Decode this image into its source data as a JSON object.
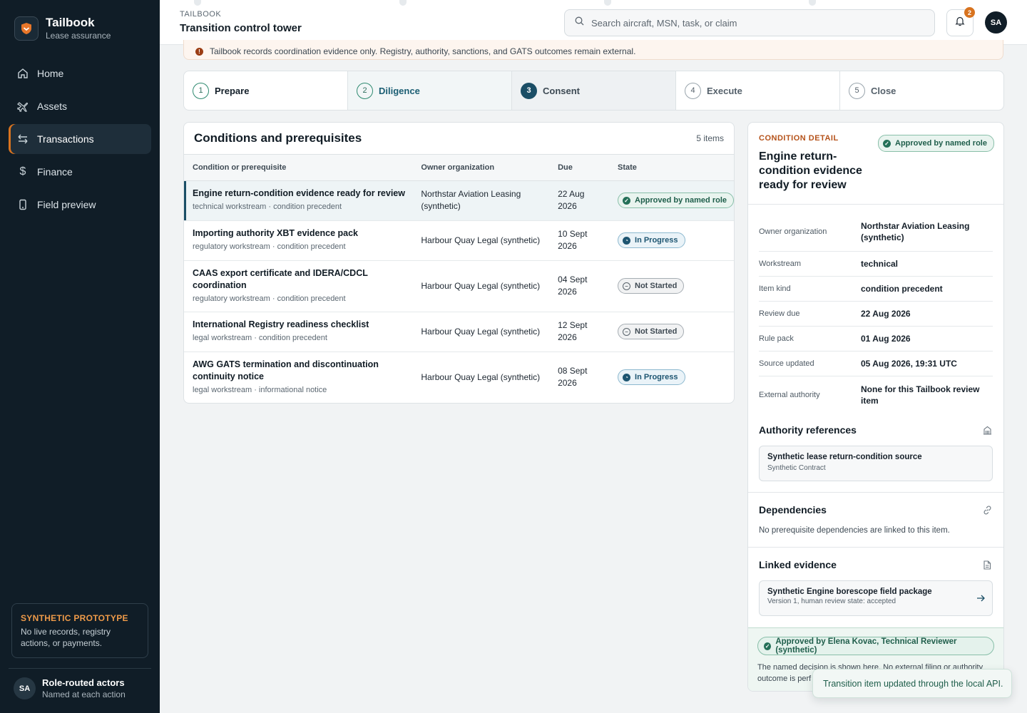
{
  "app": {
    "name": "Tailbook",
    "tagline": "Lease assurance"
  },
  "sidebar": {
    "items": [
      {
        "label": "Home",
        "icon": "home-icon",
        "active": false
      },
      {
        "label": "Assets",
        "icon": "plane-icon",
        "active": false
      },
      {
        "label": "Transactions",
        "icon": "swap-icon",
        "active": true
      },
      {
        "label": "Finance",
        "icon": "dollar-icon",
        "active": false
      },
      {
        "label": "Field preview",
        "icon": "phone-icon",
        "active": false
      }
    ],
    "prototype": {
      "title": "SYNTHETIC PROTOTYPE",
      "text": "No live records, registry actions, or payments."
    },
    "actor": {
      "initials": "SA",
      "name": "Role-routed actors",
      "subtitle": "Named at each action"
    }
  },
  "header": {
    "eyebrow": "TAILBOOK",
    "title": "Transition control tower",
    "search_placeholder": "Search aircraft, MSN, task, or claim",
    "notification_count": "2",
    "user_initials": "SA"
  },
  "notice": {
    "text": "Tailbook records coordination evidence only. Registry, authority, sanctions, and GATS outcomes remain external."
  },
  "steps": [
    {
      "num": "1",
      "label": "Prepare",
      "status": "done"
    },
    {
      "num": "2",
      "label": "Diligence",
      "status": "diligence"
    },
    {
      "num": "3",
      "label": "Consent",
      "status": "current"
    },
    {
      "num": "4",
      "label": "Execute",
      "status": "todo"
    },
    {
      "num": "5",
      "label": "Close",
      "status": "todo"
    }
  ],
  "conditions": {
    "title": "Conditions and prerequisites",
    "count": "5 items",
    "columns": {
      "item": "Condition or prerequisite",
      "owner": "Owner organization",
      "due": "Due",
      "state": "State"
    },
    "rows": [
      {
        "title": "Engine return-condition evidence ready for review",
        "meta": "technical workstream · condition precedent",
        "owner": "Northstar Aviation Leasing (synthetic)",
        "due": "22 Aug 2026",
        "state": "Approved by named role",
        "state_kind": "approved",
        "selected": true
      },
      {
        "title": "Importing authority XBT evidence pack",
        "meta": "regulatory workstream · condition precedent",
        "owner": "Harbour Quay Legal (synthetic)",
        "due": "10 Sept 2026",
        "state": "In Progress",
        "state_kind": "progress",
        "selected": false
      },
      {
        "title": "CAAS export certificate and IDERA/CDCL coordination",
        "meta": "regulatory workstream · condition precedent",
        "owner": "Harbour Quay Legal (synthetic)",
        "due": "04 Sept 2026",
        "state": "Not Started",
        "state_kind": "notstarted",
        "selected": false
      },
      {
        "title": "International Registry readiness checklist",
        "meta": "legal workstream · condition precedent",
        "owner": "Harbour Quay Legal (synthetic)",
        "due": "12 Sept 2026",
        "state": "Not Started",
        "state_kind": "notstarted",
        "selected": false
      },
      {
        "title": "AWG GATS termination and discontinuation continuity notice",
        "meta": "legal workstream · informational notice",
        "owner": "Harbour Quay Legal (synthetic)",
        "due": "08 Sept 2026",
        "state": "In Progress",
        "state_kind": "progress",
        "selected": false
      }
    ]
  },
  "detail": {
    "eyebrow": "CONDITION DETAIL",
    "title": "Engine return-condition evidence ready for review",
    "state": "Approved by named role",
    "fields": [
      {
        "label": "Owner organization",
        "value": "Northstar Aviation Leasing (synthetic)"
      },
      {
        "label": "Workstream",
        "value": "technical"
      },
      {
        "label": "Item kind",
        "value": "condition precedent"
      },
      {
        "label": "Review due",
        "value": "22 Aug 2026"
      },
      {
        "label": "Rule pack",
        "value": "01 Aug 2026"
      },
      {
        "label": "Source updated",
        "value": "05 Aug 2026, 19:31 UTC"
      },
      {
        "label": "External authority",
        "value": "None for this Tailbook review item"
      }
    ],
    "authority": {
      "title": "Authority references",
      "ref_title": "Synthetic lease return-condition source",
      "ref_sub": "Synthetic Contract"
    },
    "dependencies": {
      "title": "Dependencies",
      "text": "No prerequisite dependencies are linked to this item."
    },
    "evidence": {
      "title": "Linked evidence",
      "item_title": "Synthetic Engine borescope field package",
      "item_sub": "Version 1, human review state: accepted"
    },
    "decision": {
      "label": "Approved by Elena Kovac, Technical Reviewer (synthetic)",
      "text": "The named decision is shown here. No external filing or authority outcome is perf"
    }
  },
  "toast": {
    "text": "Transition item updated through the local API."
  },
  "colors": {
    "sidebar": "#101d27",
    "accent": "#d8731f",
    "primary": "#1b4e66",
    "success": "#247058"
  }
}
